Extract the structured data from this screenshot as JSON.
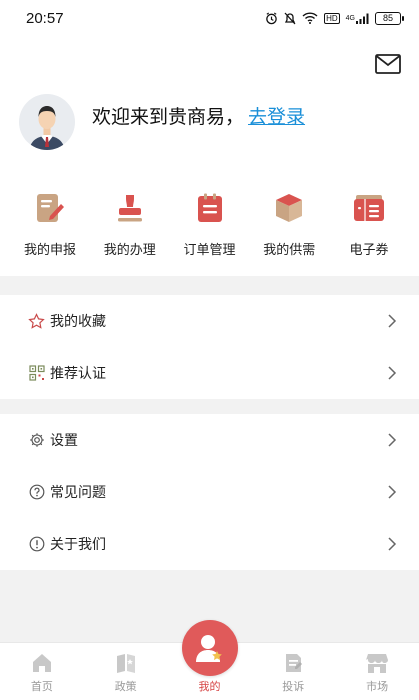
{
  "status_bar": {
    "time": "20:57",
    "battery": "85",
    "hd_label": "HD",
    "network_label": "4G"
  },
  "header": {
    "welcome_text": "欢迎来到贵商易，",
    "login_link": "去登录"
  },
  "quick_actions": [
    {
      "label": "我的申报",
      "icon": "edit-document-icon"
    },
    {
      "label": "我的办理",
      "icon": "stamp-icon"
    },
    {
      "label": "订单管理",
      "icon": "clipboard-list-icon"
    },
    {
      "label": "我的供需",
      "icon": "box-icon"
    },
    {
      "label": "电子券",
      "icon": "coupon-icon"
    }
  ],
  "menu_group_1": [
    {
      "label": "我的收藏",
      "icon": "star-icon"
    },
    {
      "label": "推荐认证",
      "icon": "qr-code-icon"
    }
  ],
  "menu_group_2": [
    {
      "label": "设置",
      "icon": "gear-icon"
    },
    {
      "label": "常见问题",
      "icon": "question-icon"
    },
    {
      "label": "关于我们",
      "icon": "info-icon"
    }
  ],
  "tabbar": {
    "items": [
      {
        "label": "首页",
        "icon": "home-icon"
      },
      {
        "label": "政策",
        "icon": "policy-book-icon"
      },
      {
        "label": "我的",
        "icon": "user-profile-icon"
      },
      {
        "label": "投诉",
        "icon": "complaint-icon"
      },
      {
        "label": "市场",
        "icon": "store-icon"
      }
    ],
    "active_index": 2
  },
  "colors": {
    "accent": "#d64545",
    "quick_icon_red": "#d9534f",
    "quick_icon_tan": "#c9a483",
    "link": "#1a8fd8"
  }
}
